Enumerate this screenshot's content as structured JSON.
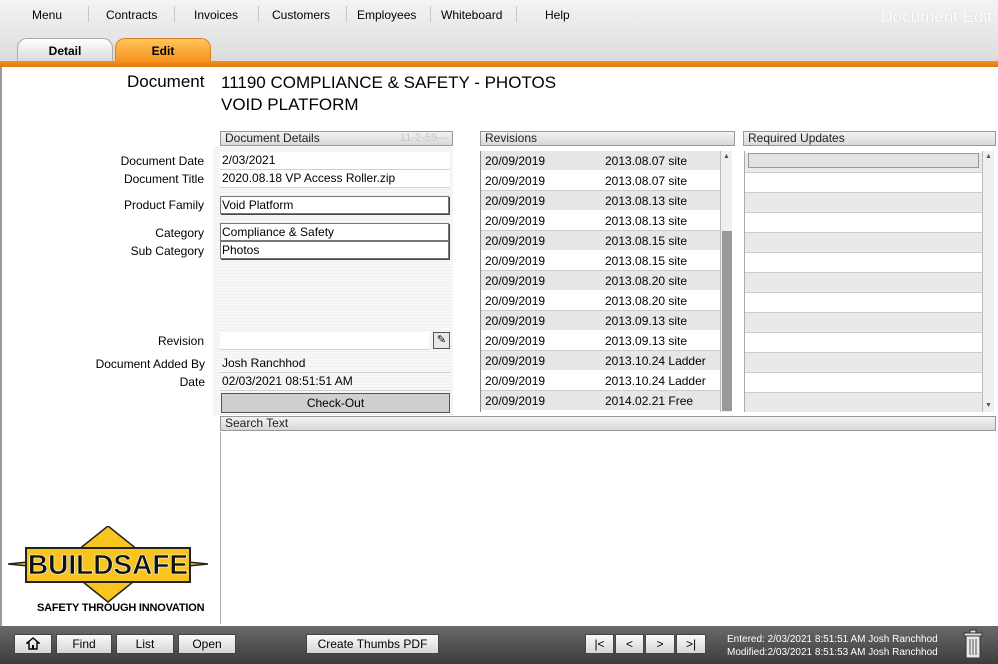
{
  "menu": {
    "items": [
      "Menu",
      "Contracts",
      "Invoices",
      "Customers",
      "Employees",
      "Whiteboard",
      "Help"
    ],
    "screen_title": "Document Edit"
  },
  "tabs": {
    "detail": "Detail",
    "edit": "Edit"
  },
  "document": {
    "label": "Document",
    "title_line1": "11190 COMPLIANCE & SAFETY - PHOTOS",
    "title_line2": "VOID PLATFORM"
  },
  "details": {
    "header": "Document Details",
    "header_faint": "11-2-59—",
    "date_label": "Document Date",
    "date_value": "2/03/2021",
    "title_label": "Document Title",
    "title_value": "2020.08.18 VP Access Roller.zip",
    "family_label": "Product Family",
    "family_value": "Void Platform",
    "category_label": "Category",
    "category_value": "Compliance & Safety",
    "subcategory_label": "Sub Category",
    "subcategory_value": "Photos",
    "revision_label": "Revision",
    "revision_value": "",
    "added_by_label": "Document Added By",
    "added_by_value": "Josh Ranchhod",
    "added_date_label": "Date",
    "added_date_value": "02/03/2021 08:51:51 AM",
    "checkout_label": "Check-Out"
  },
  "revisions": {
    "header": "Revisions",
    "rows": [
      {
        "date": "20/09/2019",
        "name": "2013.08.07 site"
      },
      {
        "date": "20/09/2019",
        "name": "2013.08.07 site"
      },
      {
        "date": "20/09/2019",
        "name": "2013.08.13 site"
      },
      {
        "date": "20/09/2019",
        "name": "2013.08.13 site"
      },
      {
        "date": "20/09/2019",
        "name": "2013.08.15 site"
      },
      {
        "date": "20/09/2019",
        "name": "2013.08.15 site"
      },
      {
        "date": "20/09/2019",
        "name": "2013.08.20 site"
      },
      {
        "date": "20/09/2019",
        "name": "2013.08.20 site"
      },
      {
        "date": "20/09/2019",
        "name": "2013.09.13 site"
      },
      {
        "date": "20/09/2019",
        "name": "2013.09.13 site"
      },
      {
        "date": "20/09/2019",
        "name": "2013.10.24 Ladder"
      },
      {
        "date": "20/09/2019",
        "name": "2013.10.24 Ladder"
      },
      {
        "date": "20/09/2019",
        "name": "2014.02.21 Free"
      }
    ]
  },
  "required_updates": {
    "header": "Required Updates"
  },
  "search_text": {
    "header": "Search Text",
    "value": ""
  },
  "logo": {
    "brand": "BUILDSAFE",
    "tagline": "SAFETY THROUGH INNOVATION"
  },
  "bottom": {
    "home_icon": "home-icon",
    "find": "Find",
    "list": "List",
    "open": "Open",
    "create_thumbs": "Create Thumbs PDF",
    "nav_first": "|<",
    "nav_prev": "<",
    "nav_next": ">",
    "nav_last": ">|",
    "entered": "Entered:  2/03/2021 8:51:51 AM Josh Ranchhod",
    "modified": "Modified:2/03/2021 8:51:53 AM Josh Ranchhod",
    "trash_icon": "trash-icon"
  },
  "colors": {
    "accent": "#f5901e",
    "bottom_bar": "#4a4a4a",
    "logo_yellow": "#f7c51e"
  }
}
